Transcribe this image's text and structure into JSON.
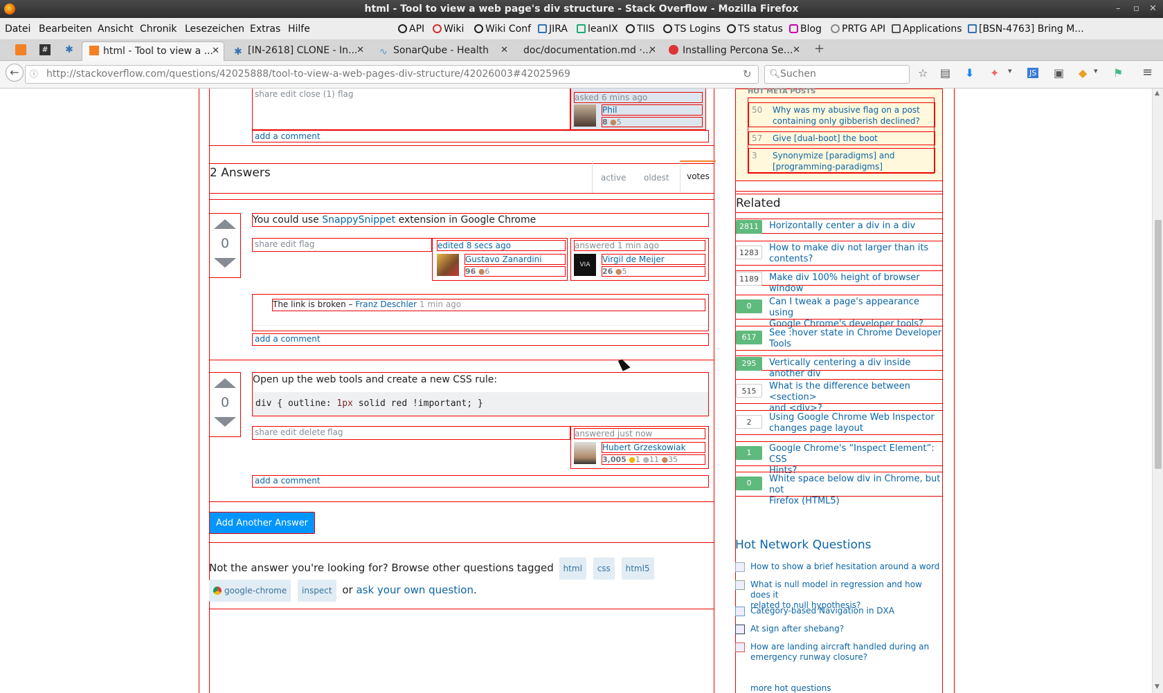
{
  "window": {
    "title": "html - Tool to view a web page's div structure - Stack Overflow - Mozilla Firefox"
  },
  "menu": [
    "Datei",
    "Bearbeiten",
    "Ansicht",
    "Chronik",
    "Lesezeichen",
    "Extras",
    "Hilfe"
  ],
  "bookmarks": [
    "API",
    "Wiki",
    "Wiki Conf",
    "JIRA",
    "leanIX",
    "TIIS",
    "TS Logins",
    "TS status",
    "Blog",
    "PRTG API",
    "Applications",
    "[BSN-4763] Bring M..."
  ],
  "tabs": [
    {
      "label": "html - Tool to view a ...",
      "active": true
    },
    {
      "label": "[IN-2618] CLONE - In..."
    },
    {
      "label": "SonarQube - Health"
    },
    {
      "label": "doc/documentation.md ·..."
    },
    {
      "label": "Installing Percona Se..."
    }
  ],
  "urlbar": {
    "url": "http://stackoverflow.com/questions/42025888/tool-to-view-a-web-pages-div-structure/42026003#42025969"
  },
  "searchbar": {
    "placeholder": "Suchen"
  },
  "question": {
    "actions": [
      "share",
      "edit",
      "close (1)",
      "flag"
    ],
    "asked_label": "asked 6 mins ago",
    "user": "Phil",
    "user_rep": "8",
    "user_badge_bronze": "5",
    "add_comment": "add a comment"
  },
  "answers_header": {
    "title": "2 Answers",
    "sort_tabs": [
      "active",
      "oldest",
      "votes"
    ]
  },
  "answer1": {
    "votes": "0",
    "text_before": "You could use ",
    "link": "SnappySnippet",
    "text_after": " extension in Google Chrome",
    "actions": [
      "share",
      "edit",
      "flag"
    ],
    "edited_label": "edited 8 secs ago",
    "editor": "Gustavo Zanardini",
    "editor_rep": "96",
    "editor_bronze": "6",
    "answered_label": "answered 1 min ago",
    "author": "Virgil de Meijer",
    "author_rep": "26",
    "author_bronze": "5",
    "comment_text": "The link is broken – ",
    "comment_user": "Franz Deschler",
    "comment_time": "1 min ago",
    "add_comment": "add a comment"
  },
  "answer2": {
    "votes": "0",
    "text": "Open up the web tools and create a new CSS rule:",
    "code_prefix": "div { outline: ",
    "code_num": "1px",
    "code_suffix": " solid red !important; }",
    "actions": [
      "share",
      "edit",
      "delete",
      "flag"
    ],
    "answered_label": "answered just now",
    "author": "Hubert Grzeskowiak",
    "author_rep": "3,005",
    "gold": "1",
    "silver": "11",
    "bronze": "35",
    "add_comment": "add a comment"
  },
  "add_answer_button": "Add Another Answer",
  "footer_prompt": {
    "text": "Not the answer you're looking for? Browse other questions tagged",
    "tags": [
      "html",
      "css",
      "html5",
      "google-chrome",
      "inspect"
    ],
    "or": "or",
    "ask_link": "ask your own question",
    "period": "."
  },
  "hot_meta": {
    "header": "HOT META POSTS",
    "items": [
      {
        "count": "50",
        "title_l1": "Why was my abusive flag on a post",
        "title_l2": "containing only gibberish declined?"
      },
      {
        "count": "57",
        "title_l1": "Give [dual-boot] the boot",
        "title_l2": ""
      },
      {
        "count": "3",
        "title_l1": "Synonymize [paradigms] and",
        "title_l2": "[programming-paradigms]"
      }
    ]
  },
  "related": {
    "header": "Related",
    "items": [
      {
        "count": "2811",
        "answered": true,
        "l1": "Horizontally center a div in a div",
        "l2": ""
      },
      {
        "count": "1283",
        "answered": false,
        "l1": "How to make div not larger than its",
        "l2": "contents?"
      },
      {
        "count": "1189",
        "answered": false,
        "l1": "Make div 100% height of browser window",
        "l2": ""
      },
      {
        "count": "0",
        "answered": true,
        "l1": "Can I tweak a page's appearance using",
        "l2": "Google Chrome's developer tools?"
      },
      {
        "count": "617",
        "answered": true,
        "l1": "See :hover state in Chrome Developer",
        "l2": "Tools"
      },
      {
        "count": "295",
        "answered": true,
        "l1": "Vertically centering a div inside another div",
        "l2": ""
      },
      {
        "count": "515",
        "answered": false,
        "l1": "What is the difference between <section>",
        "l2": "and <div>?"
      },
      {
        "count": "2",
        "answered": false,
        "l1": "Using Google Chrome Web Inspector",
        "l2": "changes page layout"
      },
      {
        "count": "1",
        "answered": true,
        "l1": "Google Chrome's “Inspect Element”: CSS",
        "l2": "Hints?"
      },
      {
        "count": "0",
        "answered": true,
        "l1": "White space below div in Chrome, but not",
        "l2": "Firefox (HTML5)"
      }
    ]
  },
  "hot_network": {
    "header": "Hot Network Questions",
    "items": [
      {
        "l1": "How to show a brief hesitation around a word",
        "l2": ""
      },
      {
        "l1": "What is null model in regression and how does it",
        "l2": "related to null hypothesis?"
      },
      {
        "l1": "Category-based Navigation in DXA",
        "l2": ""
      },
      {
        "l1": "At sign after shebang?",
        "l2": ""
      },
      {
        "l1": "How are landing aircraft handled during an",
        "l2": "emergency runway closure?"
      }
    ],
    "more": "more hot questions"
  },
  "colors": {
    "answered_green": "#5fba7d",
    "link": "#0c65a5",
    "debug_outline": "#e00",
    "primary_button": "#0095ff"
  }
}
